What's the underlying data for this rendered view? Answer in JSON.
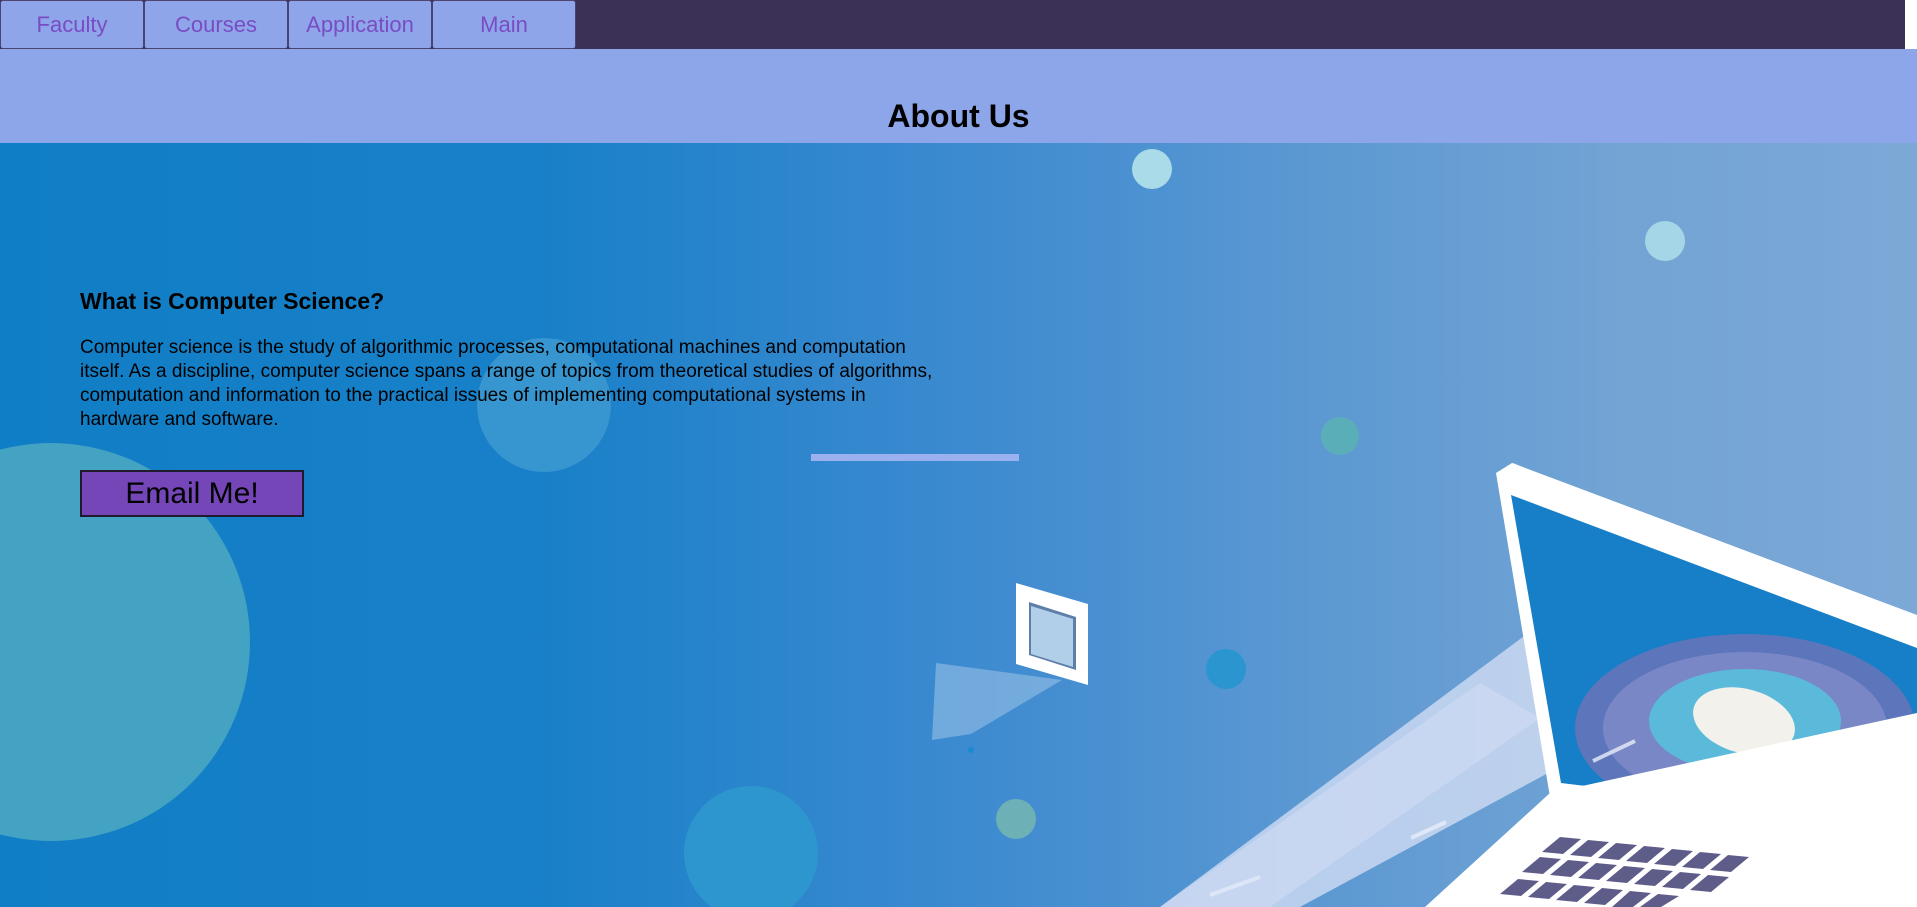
{
  "nav": {
    "items": [
      {
        "label": "Faculty"
      },
      {
        "label": "Courses"
      },
      {
        "label": "Application"
      },
      {
        "label": "Main"
      }
    ]
  },
  "header": {
    "title": "About Us"
  },
  "main": {
    "heading": "What is Computer Science?",
    "body": "Computer science is the study of algorithmic processes, computational machines and computation itself. As a discipline, computer science spans a range of topics from theoretical studies of algorithms, computation and information to the practical issues of implementing computational systems in hardware and software.",
    "email_button_label": "Email Me!"
  },
  "colors": {
    "nav_bar": "#3b3055",
    "nav_button": "#8ea6e9",
    "nav_text": "#7a4cc4",
    "header_band": "#8da6e9",
    "hero_left": "#107ec6",
    "hero_right": "#7ca8d6",
    "email_button": "#7446b7"
  },
  "icons": [
    "laptop-illustration",
    "floating-document-icon"
  ]
}
